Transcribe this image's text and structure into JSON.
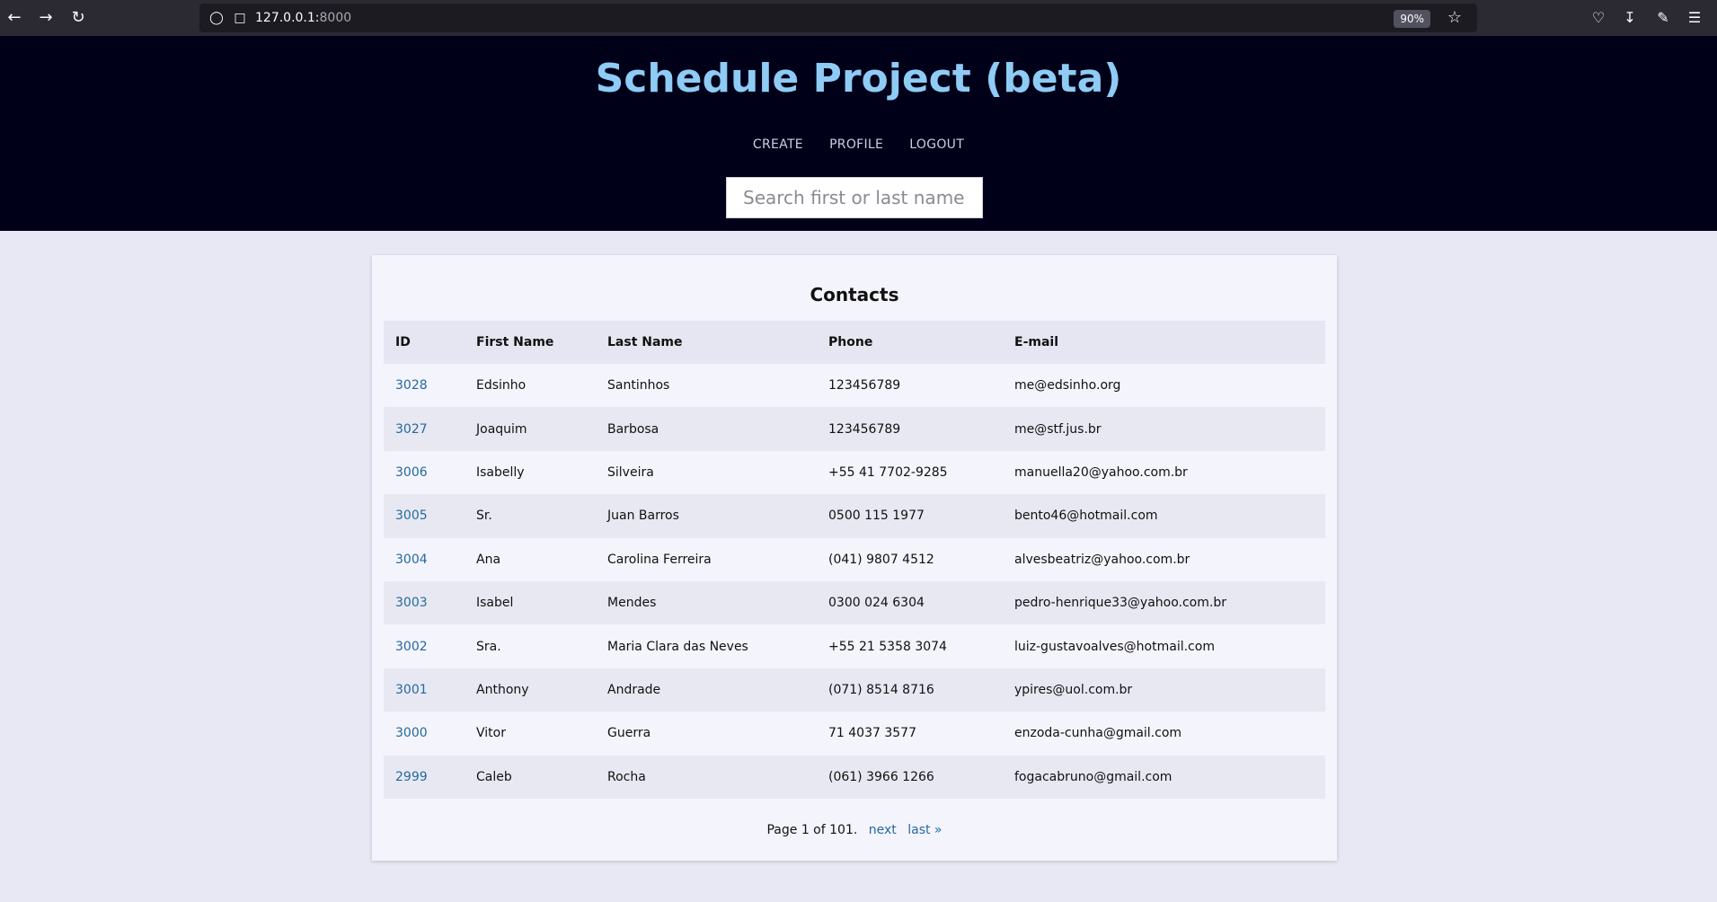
{
  "browser": {
    "url_host": "127.0.0.1:",
    "url_port": "8000",
    "zoom": "90%"
  },
  "header": {
    "title": "Schedule Project (beta)",
    "menu": [
      "CREATE",
      "PROFILE",
      "LOGOUT"
    ],
    "search_placeholder": "Search first or last name"
  },
  "contacts": {
    "title": "Contacts",
    "columns": [
      "ID",
      "First Name",
      "Last Name",
      "Phone",
      "E-mail"
    ],
    "rows": [
      {
        "id": "3028",
        "first": "Edsinho",
        "last": "Santinhos",
        "phone": "123456789",
        "email": "me@edsinho.org"
      },
      {
        "id": "3027",
        "first": "Joaquim",
        "last": "Barbosa",
        "phone": "123456789",
        "email": "me@stf.jus.br"
      },
      {
        "id": "3006",
        "first": "Isabelly",
        "last": "Silveira",
        "phone": "+55 41 7702-9285",
        "email": "manuella20@yahoo.com.br"
      },
      {
        "id": "3005",
        "first": "Sr.",
        "last": "Juan Barros",
        "phone": "0500 115 1977",
        "email": "bento46@hotmail.com"
      },
      {
        "id": "3004",
        "first": "Ana",
        "last": "Carolina Ferreira",
        "phone": "(041) 9807 4512",
        "email": "alvesbeatriz@yahoo.com.br"
      },
      {
        "id": "3003",
        "first": "Isabel",
        "last": "Mendes",
        "phone": "0300 024 6304",
        "email": "pedro-henrique33@yahoo.com.br"
      },
      {
        "id": "3002",
        "first": "Sra.",
        "last": "Maria Clara das Neves",
        "phone": "+55 21 5358 3074",
        "email": "luiz-gustavoalves@hotmail.com"
      },
      {
        "id": "3001",
        "first": "Anthony",
        "last": "Andrade",
        "phone": "(071) 8514 8716",
        "email": "ypires@uol.com.br"
      },
      {
        "id": "3000",
        "first": "Vitor",
        "last": "Guerra",
        "phone": "71 4037 3577",
        "email": "enzoda-cunha@gmail.com"
      },
      {
        "id": "2999",
        "first": "Caleb",
        "last": "Rocha",
        "phone": "(061) 3966 1266",
        "email": "fogacabruno@gmail.com"
      }
    ]
  },
  "pagination": {
    "status": "Page 1 of 101.",
    "next": "next",
    "last": "last »"
  }
}
